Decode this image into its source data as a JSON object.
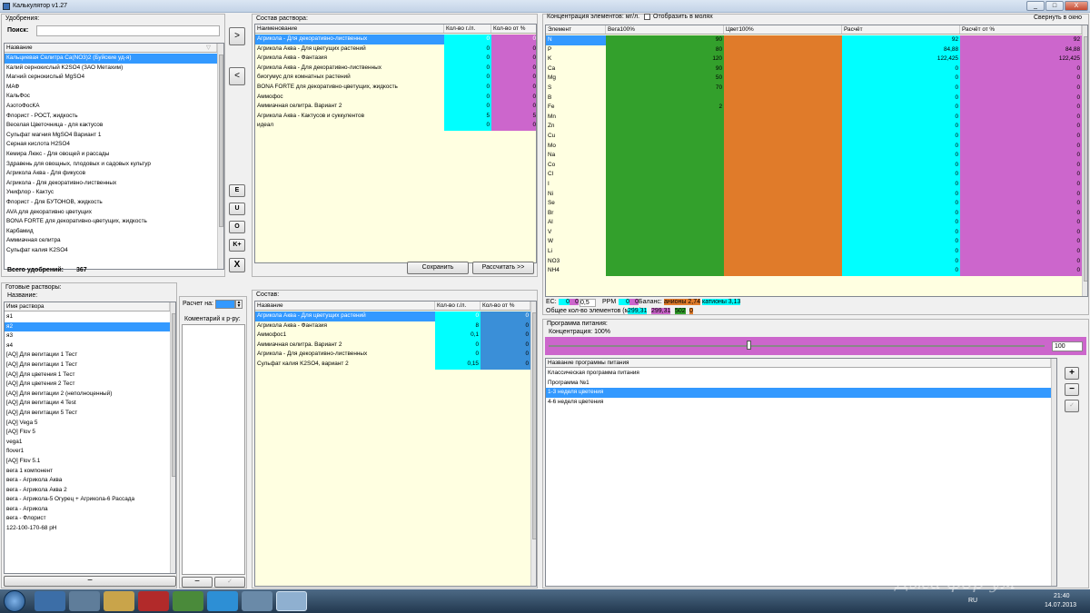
{
  "window": {
    "title": "Калькулятор v1.27",
    "controls": [
      "_",
      "□",
      "X"
    ]
  },
  "fert": {
    "group": "Удобрения:",
    "search_label": "Поиск:",
    "search_value": "",
    "col_header": "Название",
    "total_label": "Всего удобрений:",
    "total_value": "367",
    "items": [
      "Кальциевая Селитра Ca(NO3)2 (Буйские уд-я)",
      "Калий сернокислый K2SO4 (ЗАО Метахим)",
      "Магний сернокислый MgSO4",
      "МАФ",
      "КальФос",
      "АзотоФосКА",
      "Флорист - РОСТ, жидкость",
      "Веселая Цветочница - для кактусов",
      "Сульфат магния MgSO4 Вариант 1",
      "Серная кислота H2SO4",
      "Кемира Люкс - Для овощей и рассады",
      "Здравень для овощных, плодовых и садовых культур",
      "Агрикола Аква - Для фикусов",
      "Агрикола - Для декоративно-лиственных",
      "Унифлор - Кактус",
      "Флорист - Для БУТОНОВ, жидкость",
      "AVA для декоративно цветущих",
      "BONA FORTE для декоративно-цветущих, жидкость",
      "Карбамид",
      "Аммиачная селитра",
      "Сульфат калия K2SO4"
    ]
  },
  "mid_btns": [
    ">",
    "<",
    "E",
    "U",
    "O",
    "K+",
    "X"
  ],
  "comp": {
    "group": "Состав раствора:",
    "headers": [
      "Наименование",
      "Кол-во г./л.",
      "Кол-во от %"
    ],
    "rows": [
      [
        "Агрикола - Для декоративно-лиственных",
        "0",
        "0"
      ],
      [
        "Агрикола Аква - Для цветущих растений",
        "0",
        "0"
      ],
      [
        "Агрикола Аква - Фантазия",
        "0",
        "0"
      ],
      [
        "Агрикола Аква - Для декоративно-лиственных",
        "0",
        "0"
      ],
      [
        "биогумус для комнатных растений",
        "0",
        "0"
      ],
      [
        "BONA FORTE для декоративно-цветущих, жидкость",
        "0",
        "0"
      ],
      [
        "Аммофос",
        "0",
        "0"
      ],
      [
        "Аммиачная селитра. Вариант 2",
        "0",
        "0"
      ],
      [
        "Агрикола Аква - Кактусов и суккулентов",
        "5",
        "5"
      ],
      [
        "идеал",
        "0",
        "0"
      ]
    ],
    "save": "Сохранить",
    "calc": "Рассчитать >>"
  },
  "conc": {
    "group": "Концентрация элементов: мг/л.",
    "checkbox": "Отобразить в молях",
    "collapse": "Свернуть в окно",
    "headers": [
      "Элемент",
      "Вега100%",
      "Цвет100%",
      "Расчёт",
      "Расчёт от %"
    ],
    "rows": [
      [
        "N",
        "90",
        "",
        "92",
        "92"
      ],
      [
        "P",
        "80",
        "",
        "84,88",
        "84,88"
      ],
      [
        "K",
        "120",
        "",
        "122,425",
        "122,425"
      ],
      [
        "Ca",
        "90",
        "",
        "0",
        "0"
      ],
      [
        "Mg",
        "50",
        "",
        "0",
        "0"
      ],
      [
        "S",
        "70",
        "",
        "0",
        "0"
      ],
      [
        "B",
        "",
        "",
        "0",
        "0"
      ],
      [
        "Fe",
        "2",
        "",
        "0",
        "0"
      ],
      [
        "Mn",
        "",
        "",
        "0",
        "0"
      ],
      [
        "Zn",
        "",
        "",
        "0",
        "0"
      ],
      [
        "Cu",
        "",
        "",
        "0",
        "0"
      ],
      [
        "Mo",
        "",
        "",
        "0",
        "0"
      ],
      [
        "Na",
        "",
        "",
        "0",
        "0"
      ],
      [
        "Co",
        "",
        "",
        "0",
        "0"
      ],
      [
        "Cl",
        "",
        "",
        "0",
        "0"
      ],
      [
        "I",
        "",
        "",
        "0",
        "0"
      ],
      [
        "Ni",
        "",
        "",
        "0",
        "0"
      ],
      [
        "Se",
        "",
        "",
        "0",
        "0"
      ],
      [
        "Br",
        "",
        "",
        "0",
        "0"
      ],
      [
        "Al",
        "",
        "",
        "0",
        "0"
      ],
      [
        "V",
        "",
        "",
        "0",
        "0"
      ],
      [
        "W",
        "",
        "",
        "0",
        "0"
      ],
      [
        "Li",
        "",
        "",
        "0",
        "0"
      ],
      [
        "NO3",
        "",
        "",
        "0",
        "0"
      ],
      [
        "NH4",
        "",
        "",
        "0",
        "0"
      ]
    ],
    "ec_label": "EC:",
    "ec_vals": [
      "0",
      "0",
      "0,5"
    ],
    "ppm_label": "PPM",
    "ppm_vals": [
      "0",
      "0"
    ],
    "balance_label": "Баланс:",
    "anions": "анионы 2,74",
    "cations": "катионы 3,13",
    "total_label": "Общее кол-во элементов (мг./л.):",
    "total_vals": [
      "299,31",
      "299,31",
      "502",
      "0"
    ]
  },
  "ready": {
    "group": "Готовые растворы:",
    "sub": "Название:",
    "col": "Имя раствора",
    "items": [
      "я1",
      "я2",
      "я3",
      "я4",
      "[AQ] Для вегитации 1 Тест",
      "[AQ] Для вегитации 1 Тест",
      "[AQ] Для цветения 1 Тест",
      "[AQ] Для цветения 2 Тест",
      "[AQ] Для вегитации 2 (неполноценный)",
      "[AQ] Для вегитации 4 Test",
      "[AQ] Для вегитации 5 Тест",
      "[AQ] Vega 5",
      "[AQ] Flov 5",
      "vega1",
      "flover1",
      "[AQ] Flov 5.1",
      "вега 1 компонент",
      "вега - Агрикола Аква",
      "вега - Агрикола Аква 2",
      "вега - Агрикола-5 Огурец + Агрикола-6 Рассада",
      "вега - Агрикола",
      "вега - Флорист",
      "122-100-170-68 pH"
    ],
    "calc_label": "Расчет на:",
    "comment": "Коментарий к р-ру:",
    "minus": "−"
  },
  "sostav": {
    "group": "Состав:",
    "headers": [
      "Название",
      "Кол-во г./л.",
      "Кол-во от %"
    ],
    "rows": [
      [
        "Агрикола Аква - Для цветущих растений",
        "0",
        "0"
      ],
      [
        "Агрикола Аква - Фантазия",
        "8",
        "0"
      ],
      [
        "Аммофос1",
        "0,1",
        "0"
      ],
      [
        "Аммиачная селитра. Вариант 2",
        "0",
        "0"
      ],
      [
        "Агрикола - Для декоративно-лиственных",
        "0",
        "0"
      ],
      [
        "Сульфат калия K2SO4, вариант 2",
        "0,15",
        "0"
      ]
    ]
  },
  "prog": {
    "group": "Программа питания:",
    "conc_label": "Концентрация: 100%",
    "slider_value": "100",
    "col": "Название программы питания",
    "items": [
      "Классическая программа питания",
      "Программа №1",
      "1-3 неделя цветения",
      "4-6 неделя цветения"
    ],
    "buttons": [
      "+",
      "−",
      "✓"
    ]
  },
  "taskbar": {
    "lang": "RU",
    "time": "21:40",
    "date": "14.07.2013",
    "watermark": "Джа-фор-ум"
  },
  "colors": {
    "cyan": "#00ffff",
    "magenta": "#cc66cc",
    "green": "#33a02c",
    "orange": "#e07b2a",
    "select": "#3399ff",
    "light": "#ffffe1"
  }
}
